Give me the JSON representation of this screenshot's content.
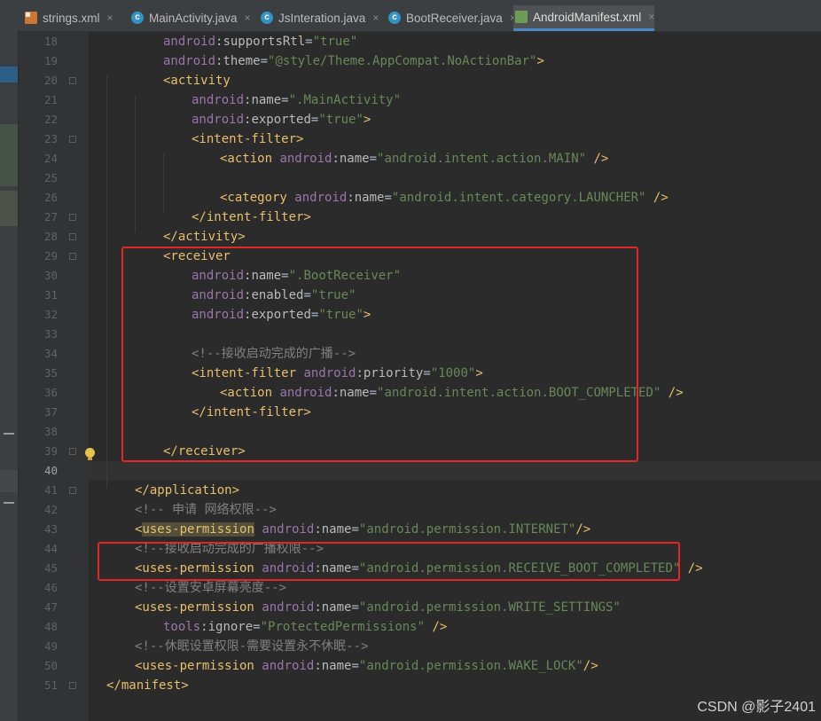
{
  "tabs": [
    {
      "label": "strings.xml",
      "icon": "xml-file-icon",
      "active": false
    },
    {
      "label": "MainActivity.java",
      "icon": "java-class-icon",
      "active": false
    },
    {
      "label": "JsInteration.java",
      "icon": "java-class-icon",
      "active": false
    },
    {
      "label": "BootReceiver.java",
      "icon": "java-class-icon",
      "active": false
    },
    {
      "label": "AndroidManifest.xml",
      "icon": "manifest-file-icon",
      "active": true
    }
  ],
  "tab_close_glyph": "×",
  "current_line": 40,
  "lines": [
    {
      "n": 18,
      "indent": 2,
      "t": [
        [
          "ns",
          "android"
        ],
        [
          "attr",
          ":supportsRtl"
        ],
        [
          "txt",
          "="
        ],
        [
          "val",
          "\"true\""
        ]
      ]
    },
    {
      "n": 19,
      "indent": 2,
      "t": [
        [
          "ns",
          "android"
        ],
        [
          "attr",
          ":theme"
        ],
        [
          "txt",
          "="
        ],
        [
          "val",
          "\"@style/Theme.AppCompat.NoActionBar\""
        ],
        [
          "tag",
          ">"
        ]
      ]
    },
    {
      "n": 20,
      "indent": 2,
      "t": [
        [
          "tag",
          "<activity"
        ]
      ]
    },
    {
      "n": 21,
      "indent": 3,
      "t": [
        [
          "ns",
          "android"
        ],
        [
          "attr",
          ":name"
        ],
        [
          "txt",
          "="
        ],
        [
          "val",
          "\".MainActivity\""
        ]
      ]
    },
    {
      "n": 22,
      "indent": 3,
      "t": [
        [
          "ns",
          "android"
        ],
        [
          "attr",
          ":exported"
        ],
        [
          "txt",
          "="
        ],
        [
          "val",
          "\"true\""
        ],
        [
          "tag",
          ">"
        ]
      ]
    },
    {
      "n": 23,
      "indent": 3,
      "t": [
        [
          "tag",
          "<intent-filter>"
        ]
      ]
    },
    {
      "n": 24,
      "indent": 4,
      "t": [
        [
          "tag",
          "<action "
        ],
        [
          "ns",
          "android"
        ],
        [
          "attr",
          ":name"
        ],
        [
          "txt",
          "="
        ],
        [
          "val",
          "\"android.intent.action.MAIN\""
        ],
        [
          "tag",
          " />"
        ]
      ]
    },
    {
      "n": 25,
      "indent": 4,
      "t": []
    },
    {
      "n": 26,
      "indent": 4,
      "t": [
        [
          "tag",
          "<category "
        ],
        [
          "ns",
          "android"
        ],
        [
          "attr",
          ":name"
        ],
        [
          "txt",
          "="
        ],
        [
          "val",
          "\"android.intent.category.LAUNCHER\""
        ],
        [
          "tag",
          " />"
        ]
      ]
    },
    {
      "n": 27,
      "indent": 3,
      "t": [
        [
          "tag",
          "</intent-filter>"
        ]
      ]
    },
    {
      "n": 28,
      "indent": 2,
      "t": [
        [
          "tag",
          "</activity>"
        ]
      ]
    },
    {
      "n": 29,
      "indent": 2,
      "t": [
        [
          "tag",
          "<receiver"
        ]
      ]
    },
    {
      "n": 30,
      "indent": 3,
      "t": [
        [
          "ns",
          "android"
        ],
        [
          "attr",
          ":name"
        ],
        [
          "txt",
          "="
        ],
        [
          "val",
          "\".BootReceiver\""
        ]
      ]
    },
    {
      "n": 31,
      "indent": 3,
      "t": [
        [
          "ns",
          "android"
        ],
        [
          "attr",
          ":enabled"
        ],
        [
          "txt",
          "="
        ],
        [
          "val",
          "\"true\""
        ]
      ]
    },
    {
      "n": 32,
      "indent": 3,
      "t": [
        [
          "ns",
          "android"
        ],
        [
          "attr",
          ":exported"
        ],
        [
          "txt",
          "="
        ],
        [
          "val",
          "\"true\""
        ],
        [
          "tag",
          ">"
        ]
      ]
    },
    {
      "n": 33,
      "indent": 3,
      "t": []
    },
    {
      "n": 34,
      "indent": 3,
      "t": [
        [
          "cmt",
          "<!--接收启动完成的广播-->"
        ]
      ]
    },
    {
      "n": 35,
      "indent": 3,
      "t": [
        [
          "tag",
          "<intent-filter "
        ],
        [
          "ns",
          "android"
        ],
        [
          "attr",
          ":priority"
        ],
        [
          "txt",
          "="
        ],
        [
          "val",
          "\"1000\""
        ],
        [
          "tag",
          ">"
        ]
      ]
    },
    {
      "n": 36,
      "indent": 4,
      "t": [
        [
          "tag",
          "<action "
        ],
        [
          "ns",
          "android"
        ],
        [
          "attr",
          ":name"
        ],
        [
          "txt",
          "="
        ],
        [
          "val",
          "\"android.intent.action.BOOT_COMPLETED\""
        ],
        [
          "tag",
          " />"
        ]
      ]
    },
    {
      "n": 37,
      "indent": 3,
      "t": [
        [
          "tag",
          "</intent-filter>"
        ]
      ]
    },
    {
      "n": 38,
      "indent": 2,
      "t": []
    },
    {
      "n": 39,
      "indent": 2,
      "t": [
        [
          "tag",
          "</receiver>"
        ]
      ]
    },
    {
      "n": 40,
      "indent": 0,
      "t": []
    },
    {
      "n": 41,
      "indent": 1,
      "t": [
        [
          "tag",
          "</application>"
        ]
      ]
    },
    {
      "n": 42,
      "indent": 1,
      "t": [
        [
          "cmt",
          "<!-- 申请 网络权限-->"
        ]
      ]
    },
    {
      "n": 43,
      "indent": 1,
      "t": [
        [
          "tag",
          "<"
        ],
        [
          "hl",
          "uses-permission"
        ],
        [
          "tag",
          " "
        ],
        [
          "ns",
          "android"
        ],
        [
          "attr",
          ":name"
        ],
        [
          "txt",
          "="
        ],
        [
          "val",
          "\"android.permission.INTERNET\""
        ],
        [
          "tag",
          "/>"
        ]
      ]
    },
    {
      "n": 44,
      "indent": 1,
      "t": [
        [
          "cmt",
          "<!--接收启动完成的广播权限-->"
        ]
      ]
    },
    {
      "n": 45,
      "indent": 1,
      "t": [
        [
          "tag",
          "<uses-permission "
        ],
        [
          "ns",
          "android"
        ],
        [
          "attr",
          ":name"
        ],
        [
          "txt",
          "="
        ],
        [
          "val",
          "\"android.permission.RECEIVE_BOOT_COMPLETED\""
        ],
        [
          "tag",
          " />"
        ]
      ]
    },
    {
      "n": 46,
      "indent": 1,
      "t": [
        [
          "cmt",
          "<!--设置安卓屏幕亮度-->"
        ]
      ]
    },
    {
      "n": 47,
      "indent": 1,
      "t": [
        [
          "tag",
          "<uses-permission "
        ],
        [
          "ns",
          "android"
        ],
        [
          "attr",
          ":name"
        ],
        [
          "txt",
          "="
        ],
        [
          "val",
          "\"android.permission.WRITE_SETTINGS\""
        ]
      ]
    },
    {
      "n": 48,
      "indent": 2,
      "t": [
        [
          "ns",
          "tools"
        ],
        [
          "attr",
          ":ignore"
        ],
        [
          "txt",
          "="
        ],
        [
          "val",
          "\"ProtectedPermissions\""
        ],
        [
          "tag",
          " />"
        ]
      ]
    },
    {
      "n": 49,
      "indent": 1,
      "t": [
        [
          "cmt",
          "<!--休眠设置权限-需要设置永不休眠-->"
        ]
      ]
    },
    {
      "n": 50,
      "indent": 1,
      "t": [
        [
          "tag",
          "<uses-permission "
        ],
        [
          "ns",
          "android"
        ],
        [
          "attr",
          ":name"
        ],
        [
          "txt",
          "="
        ],
        [
          "val",
          "\"android.permission.WAKE_LOCK\""
        ],
        [
          "tag",
          "/>"
        ]
      ]
    },
    {
      "n": 51,
      "indent": 0,
      "t": [
        [
          "tag",
          "</manifest>"
        ]
      ]
    }
  ],
  "watermark": "CSDN @影子2401",
  "colors": {
    "background": "#2b2b2b",
    "tag": "#e8bf6a",
    "namespace": "#9876aa",
    "attribute": "#bababa",
    "value": "#6a8759",
    "comment": "#808080",
    "annotation_box": "#e32727"
  }
}
